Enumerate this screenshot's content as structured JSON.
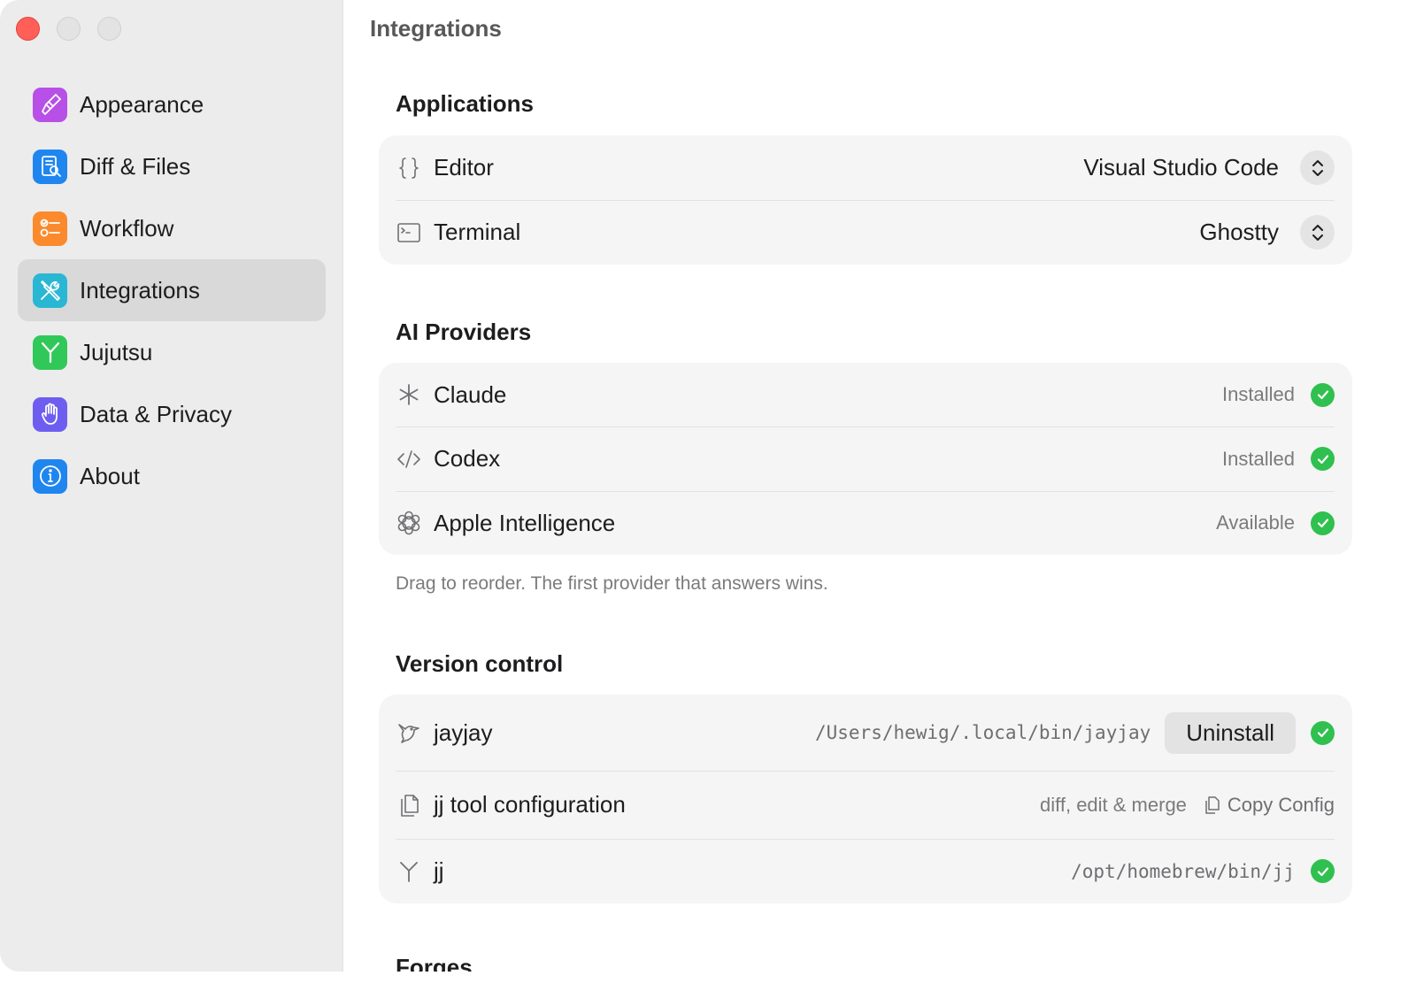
{
  "sidebar": {
    "items": [
      {
        "label": "Appearance",
        "icon": "paintbrush-icon",
        "color": "#b84fe6",
        "active": false
      },
      {
        "label": "Diff & Files",
        "icon": "document-magnifier-icon",
        "color": "#1f86f0",
        "active": false
      },
      {
        "label": "Workflow",
        "icon": "checklist-icon",
        "color": "#fb8a2c",
        "active": false
      },
      {
        "label": "Integrations",
        "icon": "tools-icon",
        "color": "#2ab7d4",
        "active": true
      },
      {
        "label": "Jujutsu",
        "icon": "branch-icon",
        "color": "#31c85a",
        "active": false
      },
      {
        "label": "Data & Privacy",
        "icon": "hand-icon",
        "color": "#6e5ef0",
        "active": false
      },
      {
        "label": "About",
        "icon": "info-icon",
        "color": "#1f86f0",
        "active": false
      }
    ]
  },
  "main": {
    "title": "Integrations",
    "applications": {
      "title": "Applications",
      "rows": [
        {
          "label": "Editor",
          "icon": "braces-icon",
          "value": "Visual Studio Code"
        },
        {
          "label": "Terminal",
          "icon": "terminal-icon",
          "value": "Ghostty"
        }
      ]
    },
    "ai_providers": {
      "title": "AI Providers",
      "rows": [
        {
          "label": "Claude",
          "icon": "asterisk-icon",
          "status": "Installed"
        },
        {
          "label": "Codex",
          "icon": "code-brackets-icon",
          "status": "Installed"
        },
        {
          "label": "Apple Intelligence",
          "icon": "apple-intelligence-icon",
          "status": "Available"
        }
      ],
      "footnote": "Drag to reorder. The first provider that answers wins."
    },
    "version_control": {
      "title": "Version control",
      "jayjay": {
        "label": "jayjay",
        "icon": "bird-icon",
        "path": "/Users/hewig/.local/bin/jayjay",
        "button": "Uninstall"
      },
      "jj_tool": {
        "label": "jj tool configuration",
        "icon": "documents-icon",
        "detail": "diff, edit & merge",
        "action": "Copy Config"
      },
      "jj": {
        "label": "jj",
        "icon": "branch-icon",
        "path": "/opt/homebrew/bin/jj"
      }
    },
    "forges": {
      "title": "Forges"
    }
  },
  "colors": {
    "success": "#30c04f",
    "close": "#ff5f57",
    "sidebar_bg": "#ececec",
    "card_bg": "#f5f5f5"
  }
}
